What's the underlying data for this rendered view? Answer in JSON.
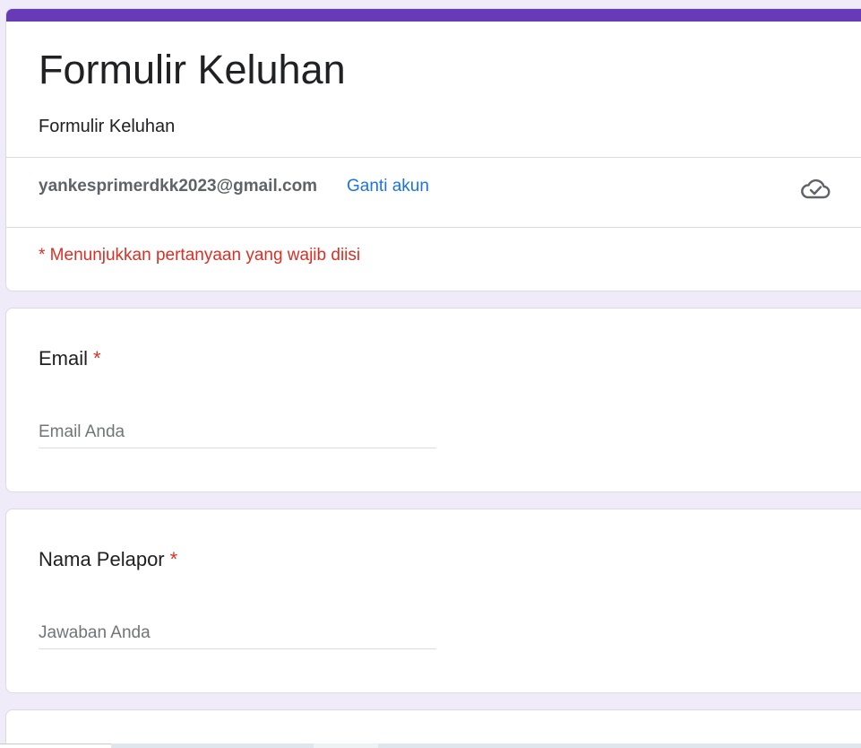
{
  "form": {
    "title": "Formulir Keluhan",
    "description": "Formulir Keluhan",
    "account_email": "yankesprimerdkk2023@gmail.com",
    "switch_account_label": "Ganti akun",
    "required_note": "* Menunjukkan pertanyaan yang wajib diisi",
    "accent_color": "#673ab7",
    "cloud_icon": "cloud-check-icon"
  },
  "questions": [
    {
      "label": "Email",
      "required_mark": "*",
      "placeholder": "Email Anda"
    },
    {
      "label": "Nama Pelapor",
      "required_mark": "*",
      "placeholder": "Jawaban Anda"
    }
  ]
}
